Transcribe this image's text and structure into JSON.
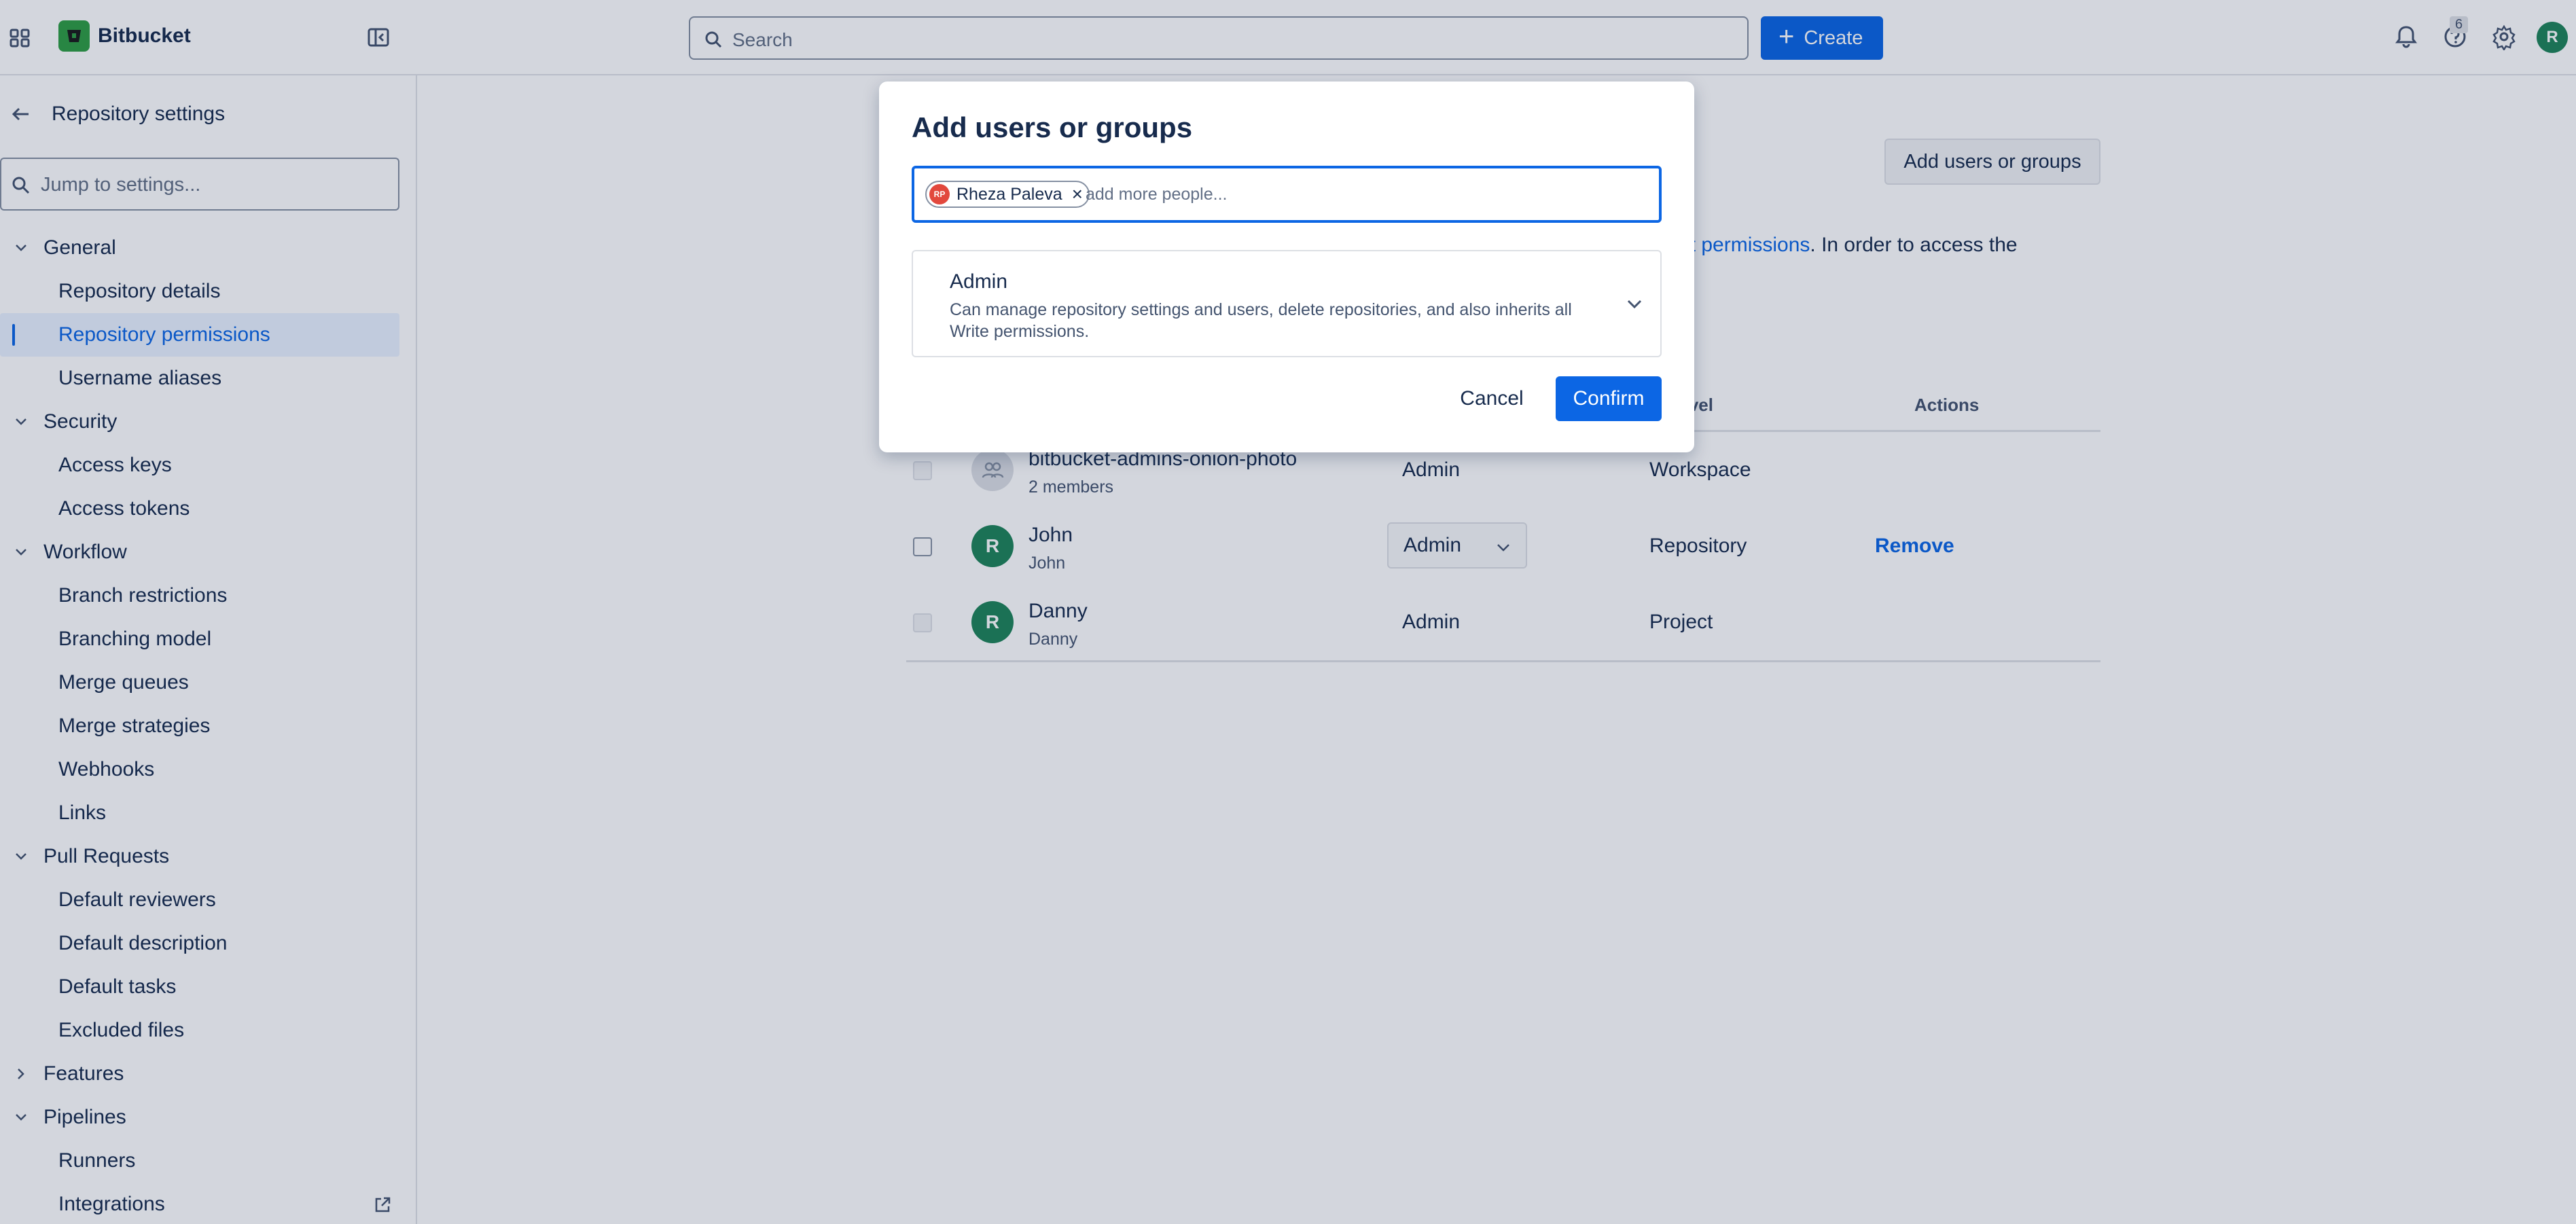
{
  "topbar": {
    "brand": "Bitbucket",
    "search_placeholder": "Search",
    "create_label": "Create",
    "help_badge": "6",
    "avatar_initial": "R"
  },
  "sidebar": {
    "back_label": "Repository settings",
    "jump_placeholder": "Jump to settings...",
    "sections": [
      {
        "label": "General",
        "expanded": true,
        "items": [
          "Repository details",
          "Repository permissions",
          "Username aliases"
        ]
      },
      {
        "label": "Security",
        "expanded": true,
        "items": [
          "Access keys",
          "Access tokens"
        ]
      },
      {
        "label": "Workflow",
        "expanded": true,
        "items": [
          "Branch restrictions",
          "Branching model",
          "Merge queues",
          "Merge strategies",
          "Webhooks",
          "Links"
        ]
      },
      {
        "label": "Pull Requests",
        "expanded": true,
        "items": [
          "Default reviewers",
          "Default description",
          "Default tasks",
          "Excluded files"
        ]
      },
      {
        "label": "Features",
        "expanded": false,
        "items": []
      },
      {
        "label": "Pipelines",
        "expanded": true,
        "items": [
          "Runners",
          "Integrations"
        ]
      }
    ],
    "active_item": "Repository permissions"
  },
  "main": {
    "add_button": "Add users or groups",
    "permissions_text_link": "ect permissions",
    "permissions_text_rest": ". In order to access the",
    "columns": {
      "access_level": "ss level",
      "actions": "Actions"
    },
    "rows": [
      {
        "name": "bitbucket-admins-onion-photo",
        "sub": "2 members",
        "permission": "Admin",
        "level": "Workspace",
        "action": "",
        "avatar": "",
        "editable": false
      },
      {
        "name": "John",
        "sub": "John",
        "permission": "Admin",
        "level": "Repository",
        "action": "Remove",
        "avatar": "R",
        "editable": true
      },
      {
        "name": "Danny",
        "sub": "Danny",
        "permission": "Admin",
        "level": "Project",
        "action": "",
        "avatar": "R",
        "editable": false
      }
    ]
  },
  "modal": {
    "title": "Add users or groups",
    "chip": {
      "initials": "RP",
      "name": "Rheza Paleva"
    },
    "input_placeholder": "add more people...",
    "role": {
      "title": "Admin",
      "description": "Can manage repository settings and users, delete repositories, and also inherits all Write permissions."
    },
    "cancel_label": "Cancel",
    "confirm_label": "Confirm"
  },
  "colors": {
    "accent": "#0c66e4",
    "brand_green": "#2f9e44",
    "avatar_green": "#1f845a",
    "chip_avatar": "#e2483d"
  }
}
